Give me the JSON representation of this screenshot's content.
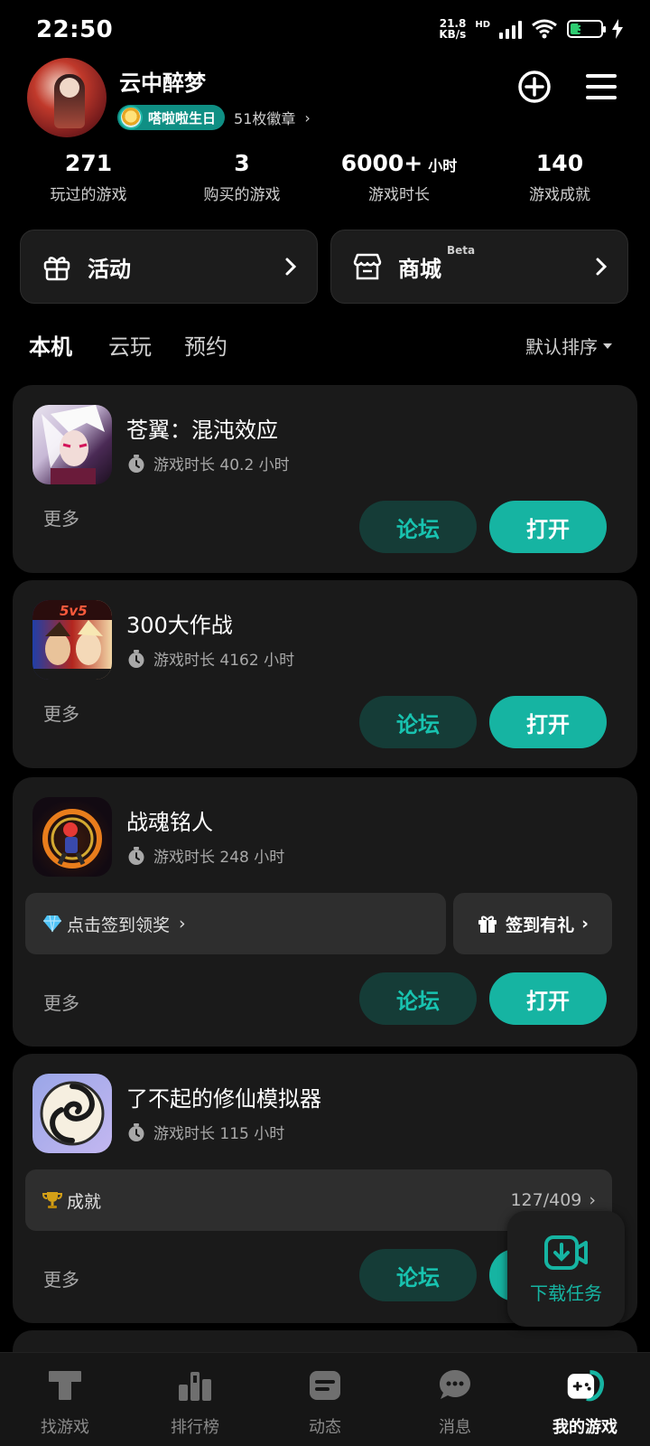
{
  "status_bar": {
    "time": "22:50",
    "net_speed_value": "21.8",
    "net_speed_unit": "KB/s",
    "network_type": "HD",
    "battery": "34",
    "battery_level": 0.34
  },
  "profile": {
    "username": "云中醉梦",
    "badge_label": "嗒啦啦生日",
    "badge_count": "51枚徽章",
    "icons": {
      "add": "add-circle-icon",
      "menu": "menu-icon"
    }
  },
  "stats": [
    {
      "value": "271",
      "unit": "",
      "label": "玩过的游戏"
    },
    {
      "value": "3",
      "unit": "",
      "label": "购买的游戏"
    },
    {
      "value": "6000+",
      "unit": "小时",
      "label": "游戏时长"
    },
    {
      "value": "140",
      "unit": "",
      "label": "游戏成就"
    }
  ],
  "tiles": {
    "activity": {
      "label": "活动",
      "icon": "gift-icon"
    },
    "store": {
      "label": "商城",
      "tag": "Beta",
      "icon": "store-icon"
    }
  },
  "tabs": [
    {
      "label": "本机",
      "active": true
    },
    {
      "label": "云玩",
      "active": false
    },
    {
      "label": "预约",
      "active": false
    }
  ],
  "sort": {
    "label": "默认排序"
  },
  "games": [
    {
      "title": "苍翼：混沌效应",
      "playtime": "游戏时长 40.2 小时",
      "more": "更多",
      "forum": "论坛",
      "open": "打开"
    },
    {
      "title": "300大作战",
      "playtime": "游戏时长 4162 小时",
      "more": "更多",
      "forum": "论坛",
      "open": "打开",
      "icon_text": "5v5"
    },
    {
      "title": "战魂铭人",
      "playtime": "游戏时长 248 小时",
      "more": "更多",
      "forum": "论坛",
      "open": "打开",
      "checkin": "点击签到领奖",
      "gift": "签到有礼"
    },
    {
      "title": "了不起的修仙模拟器",
      "playtime": "游戏时长 115 小时",
      "more": "更多",
      "forum": "论坛",
      "open": "打开",
      "achievement_label": "成就",
      "achievement_count": "127/409"
    }
  ],
  "download_task": {
    "label": "下载任务"
  },
  "bottom_nav": [
    {
      "label": "找游戏",
      "icon": "find-games-icon",
      "active": false
    },
    {
      "label": "排行榜",
      "icon": "ranking-icon",
      "active": false
    },
    {
      "label": "动态",
      "icon": "feed-icon",
      "active": false
    },
    {
      "label": "消息",
      "icon": "message-icon",
      "active": false
    },
    {
      "label": "我的游戏",
      "icon": "my-games-icon",
      "active": true
    }
  ],
  "colors": {
    "accent": "#16b4a2",
    "forum_bg": "#153c37",
    "card_bg": "#1a1a1a"
  }
}
